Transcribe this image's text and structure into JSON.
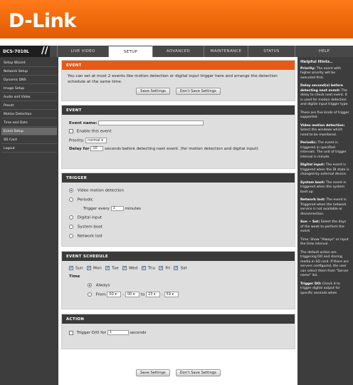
{
  "brand": {
    "logo": "D-Link"
  },
  "nav": {
    "model": "DCS-7010L",
    "tabs": [
      "LIVE VIDEO",
      "SETUP",
      "ADVANCED",
      "MAINTENANCE",
      "STATUS",
      "HELP"
    ],
    "active_tab": "SETUP"
  },
  "sidebar": {
    "items": [
      "Setup Wizard",
      "Network Setup",
      "Dynamic DNS",
      "Image Setup",
      "Audio and Video",
      "Preset",
      "Motion Detection",
      "Time and Date",
      "Event Setup",
      "SD Card",
      "Logout"
    ],
    "active": "Event Setup"
  },
  "intro": {
    "title": "EVENT",
    "text": "You can set at most 2 events like motion detection or digital input trigger here and arrange the detection schedule at the same time.",
    "save_label": "Save Settings",
    "dont_save_label": "Don't Save Settings"
  },
  "event": {
    "title": "EVENT",
    "name_label": "Event name:",
    "name_value": "",
    "enable_label": "Enable this event",
    "priority_label": "Priority:",
    "priority_value": "normal",
    "delay_label": "Delay for",
    "delay_value": "10",
    "delay_suffix": "seconds before detecting next event. (for motion detection and digital input)"
  },
  "trigger": {
    "title": "TRIGGER",
    "options": [
      "Video motion detection",
      "Periodic",
      "Digital input",
      "System boot",
      "Network lost"
    ],
    "selected": "Video motion detection",
    "every_label": "Trigger every",
    "every_value": "1",
    "every_unit": "minutes"
  },
  "schedule": {
    "title": "EVENT SCHEDULE",
    "days": [
      "Sun",
      "Mon",
      "Tue",
      "Wed",
      "Thu",
      "Fri",
      "Sat"
    ],
    "time_label": "Time",
    "always_label": "Always",
    "from_label": "From",
    "from_h": "00",
    "from_m": "00",
    "to_label": "to",
    "to_h": "23",
    "to_m": "59"
  },
  "action": {
    "title": "ACTION",
    "trigger_label": "Trigger D/O for",
    "trigger_value": "1",
    "trigger_unit": "seconds"
  },
  "bottom": {
    "save_label": "Save Settings",
    "dont_save_label": "Don't Save Settings"
  },
  "help": {
    "title": "Helpful Hints..",
    "paras": [
      {
        "b": "Priority:",
        "t": " The event with higher priority will be executed first."
      },
      {
        "b": "Delay second(s) before detecting next event:",
        "t": " The delay to check next event. It is used for motion detection and digital input trigger type."
      },
      {
        "b": "",
        "t": "There are five kinds of trigger supported."
      },
      {
        "b": "Video motion detection:",
        "t": " Select the windows which need to be monitored."
      },
      {
        "b": "Periodic:",
        "t": " The event is triggered in specified intervals. The unit of trigger interval is minute."
      },
      {
        "b": "Digital input:",
        "t": " The event is triggered when the DI state is changed by external device."
      },
      {
        "b": "System boot:",
        "t": " The event is triggered when the system boot up."
      },
      {
        "b": "Network lost:",
        "t": " The event is Triggered when the network service is not available or disconnection."
      },
      {
        "b": "Sun ~ Sat:",
        "t": " Select the days of the week to perform the event."
      },
      {
        "b": "",
        "t": "Time: Show \"Always\" or input the time interval."
      },
      {
        "b": "",
        "t": "The default action are triggering DO and storing media in SD card. If there are servers configured, the user can select them from \"Server name\" list."
      },
      {
        "b": "Trigger DO:",
        "t": " Check it to trigger digital output for specific seconds when"
      }
    ]
  }
}
